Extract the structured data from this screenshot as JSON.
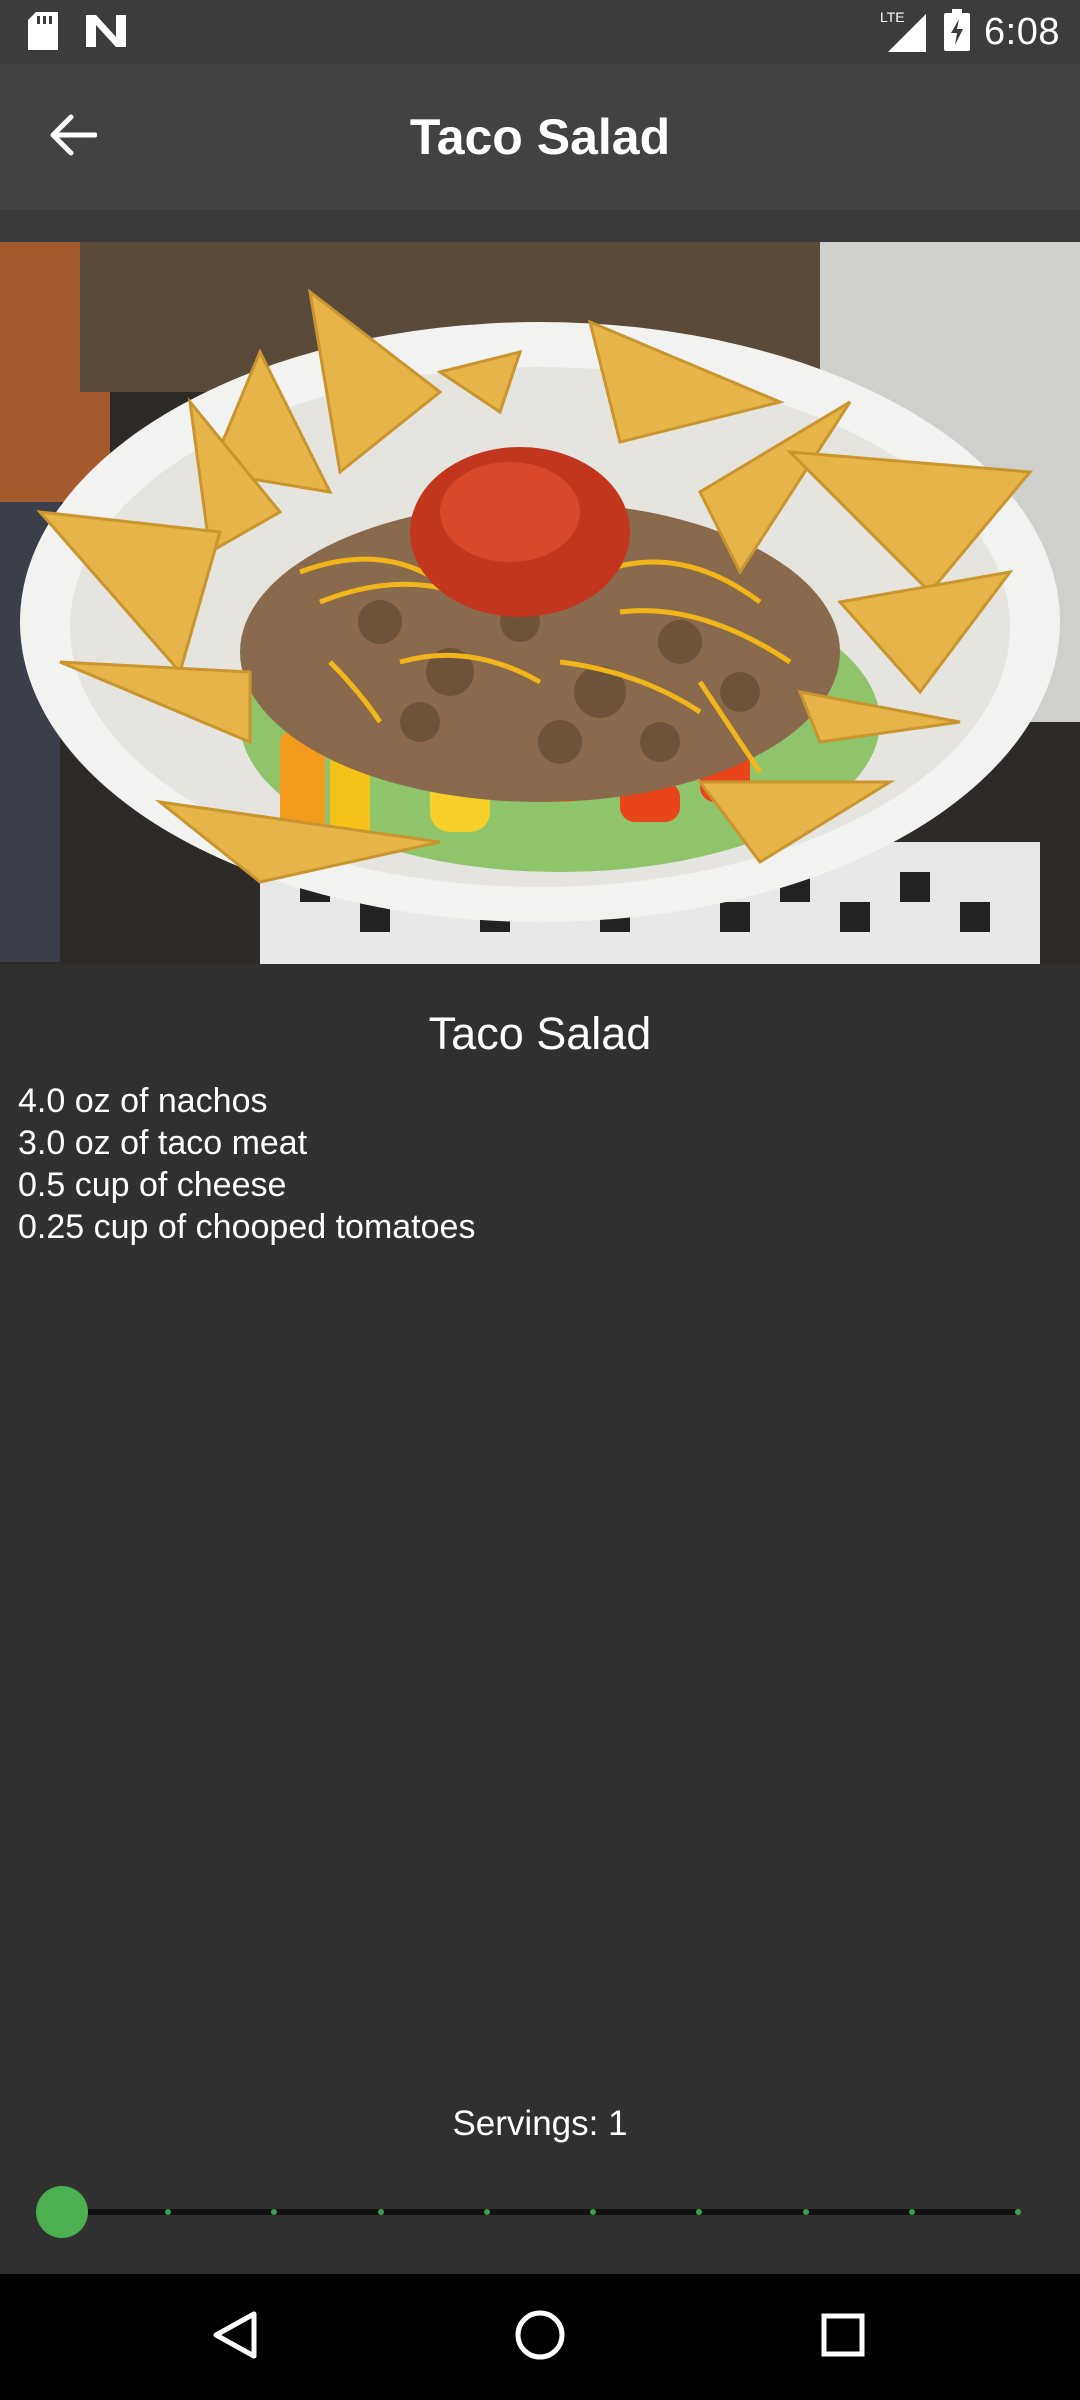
{
  "status_bar": {
    "time": "6:08",
    "network": "LTE",
    "icons": [
      "sd-card-icon",
      "n-logo-icon",
      "lte-signal-icon",
      "battery-charging-icon"
    ]
  },
  "app_bar": {
    "title": "Taco Salad",
    "back_icon": "arrow-left-icon"
  },
  "recipe": {
    "name": "Taco Salad",
    "image": "taco-salad-photo",
    "ingredients": [
      "4.0 oz of nachos",
      "3.0 oz of taco meat",
      "0.5 cup of cheese",
      "0.25 cup of chooped tomatoes"
    ]
  },
  "servings": {
    "label": "Servings: 1",
    "value": 1,
    "min": 1,
    "max": 10
  },
  "nav_bar": {
    "icons": [
      "back-triangle-icon",
      "home-circle-icon",
      "recents-square-icon"
    ]
  },
  "colors": {
    "background": "#303030",
    "app_bar": "#424242",
    "status_bar": "#3c3c3c",
    "accent": "#4caf50"
  }
}
